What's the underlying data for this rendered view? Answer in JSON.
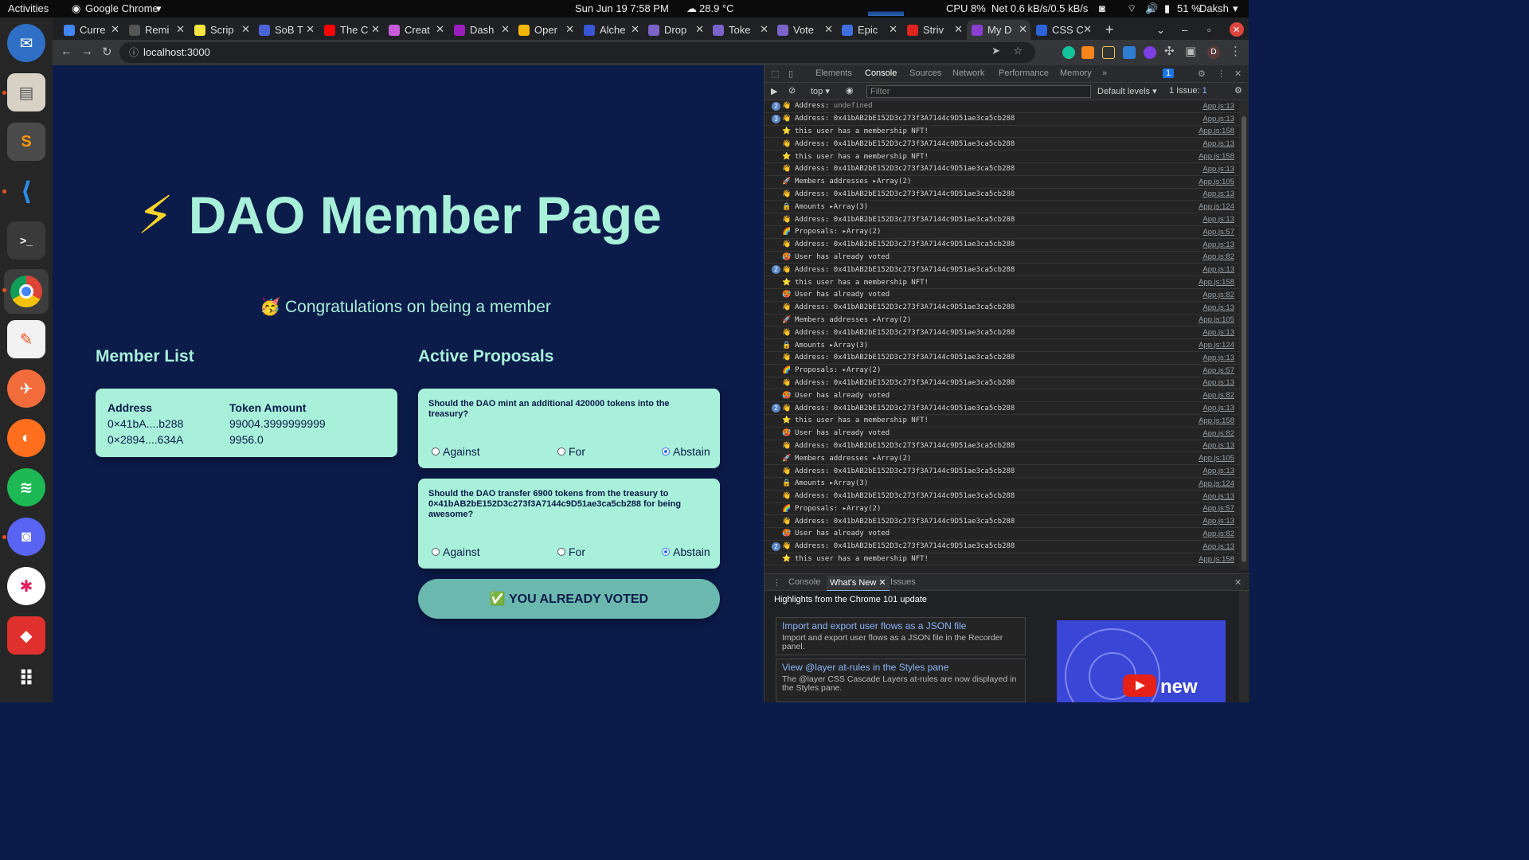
{
  "topbar": {
    "activities": "Activities",
    "app_name": "Google Chrome",
    "clock": "Sun Jun 19  7:58 PM",
    "weather": "28.9 °C",
    "cpu": "CPU 8%",
    "net": "Net 0.6 kB/s/0.5 kB/s",
    "battery": "51 %",
    "user": "Daksh"
  },
  "browser": {
    "tabs": [
      {
        "label": "Curre",
        "color": "#4285f4"
      },
      {
        "label": "Remi",
        "color": "#555555"
      },
      {
        "label": "Scrip",
        "color": "#f5e642"
      },
      {
        "label": "SoB T",
        "color": "#4b63d8"
      },
      {
        "label": "The C",
        "color": "#ff0000"
      },
      {
        "label": "Creat",
        "color": "#c85bd8"
      },
      {
        "label": "Dash",
        "color": "#9b1fbf"
      },
      {
        "label": "Oper",
        "color": "#f2b807"
      },
      {
        "label": "Alche",
        "color": "#3956d6"
      },
      {
        "label": "Drop",
        "color": "#7a63c9"
      },
      {
        "label": "Toke",
        "color": "#7a63c9"
      },
      {
        "label": "Vote",
        "color": "#7a63c9"
      },
      {
        "label": "Epic",
        "color": "#3f6fe0"
      },
      {
        "label": "Striv",
        "color": "#e0251f"
      },
      {
        "label": "My D",
        "color": "#8b3fd0"
      },
      {
        "label": "CSS C",
        "color": "#2d63d8"
      }
    ],
    "new_tab": "+",
    "url": "localhost:3000"
  },
  "page": {
    "bolt": "⚡",
    "title": "DAO Member Page",
    "congrats_emoji": "🥳",
    "congrats": "Congratulations on being a member",
    "member_list_heading": "Member List",
    "members_headers": {
      "address": "Address",
      "amount": "Token Amount"
    },
    "members": [
      {
        "address": "0×41bA....b288",
        "amount": "99004.3999999999"
      },
      {
        "address": "0×2894....634A",
        "amount": "9956.0"
      }
    ],
    "proposals_heading": "Active Proposals",
    "proposals": [
      {
        "question": "Should the DAO mint an additional 420000 tokens into the treasury?",
        "options": [
          "Against",
          "For",
          "Abstain"
        ],
        "selected": "Abstain"
      },
      {
        "question": "Should the DAO transfer 6900 tokens from the treasury to 0×41bAB2bE152D3c273f3A7144c9D51ae3ca5cb288 for being awesome?",
        "options": [
          "Against",
          "For",
          "Abstain"
        ],
        "selected": "Abstain"
      }
    ],
    "voted_button": "✅ YOU ALREADY VOTED"
  },
  "devtools": {
    "tabs": [
      "Elements",
      "Console",
      "Sources",
      "Network",
      "Performance",
      "Memory"
    ],
    "selected_tab": "Console",
    "issues_badge": "1",
    "context": "top",
    "filter_placeholder": "Filter",
    "levels": "Default levels",
    "issue_count": "1 Issue:",
    "issue_num": "1",
    "logs": [
      {
        "count": "2",
        "emoji": "👋",
        "msg": "Address: ",
        "extra": "undefined",
        "src": "App.js:13"
      },
      {
        "count": "3",
        "emoji": "👋",
        "msg": "Address: 0x41bAB2bE152D3c273f3A7144c9D51ae3ca5cb288",
        "src": "App.js:13"
      },
      {
        "emoji": "⭐",
        "msg": "this user has a membership NFT!",
        "src": "App.js:158"
      },
      {
        "emoji": "👋",
        "msg": "Address: 0x41bAB2bE152D3c273f3A7144c9D51ae3ca5cb288",
        "src": "App.js:13"
      },
      {
        "emoji": "⭐",
        "msg": "this user has a membership NFT!",
        "src": "App.js:158"
      },
      {
        "emoji": "👋",
        "msg": "Address: 0x41bAB2bE152D3c273f3A7144c9D51ae3ca5cb288",
        "src": "App.js:13"
      },
      {
        "emoji": "🚀",
        "msg": "Members addresses ▸Array(2)",
        "src": "App.js:105"
      },
      {
        "emoji": "👋",
        "msg": "Address: 0x41bAB2bE152D3c273f3A7144c9D51ae3ca5cb288",
        "src": "App.js:13"
      },
      {
        "emoji": "🔒",
        "msg": "Amounts ▸Array(3)",
        "src": "App.js:124"
      },
      {
        "emoji": "👋",
        "msg": "Address: 0x41bAB2bE152D3c273f3A7144c9D51ae3ca5cb288",
        "src": "App.js:13"
      },
      {
        "emoji": "🌈",
        "msg": "Proposals: ▸Array(2)",
        "src": "App.js:57"
      },
      {
        "emoji": "👋",
        "msg": "Address: 0x41bAB2bE152D3c273f3A7144c9D51ae3ca5cb288",
        "src": "App.js:13"
      },
      {
        "emoji": "🥵",
        "msg": "User has already voted",
        "src": "App.js:82"
      },
      {
        "count": "2",
        "emoji": "👋",
        "msg": "Address: 0x41bAB2bE152D3c273f3A7144c9D51ae3ca5cb288",
        "src": "App.js:13"
      },
      {
        "emoji": "⭐",
        "msg": "this user has a membership NFT!",
        "src": "App.js:158"
      },
      {
        "emoji": "🥵",
        "msg": "User has already voted",
        "src": "App.js:82"
      },
      {
        "emoji": "👋",
        "msg": "Address: 0x41bAB2bE152D3c273f3A7144c9D51ae3ca5cb288",
        "src": "App.js:13"
      },
      {
        "emoji": "🚀",
        "msg": "Members addresses ▸Array(2)",
        "src": "App.js:105"
      },
      {
        "emoji": "👋",
        "msg": "Address: 0x41bAB2bE152D3c273f3A7144c9D51ae3ca5cb288",
        "src": "App.js:13"
      },
      {
        "emoji": "🔒",
        "msg": "Amounts ▸Array(3)",
        "src": "App.js:124"
      },
      {
        "emoji": "👋",
        "msg": "Address: 0x41bAB2bE152D3c273f3A7144c9D51ae3ca5cb288",
        "src": "App.js:13"
      },
      {
        "emoji": "🌈",
        "msg": "Proposals: ▸Array(2)",
        "src": "App.js:57"
      },
      {
        "emoji": "👋",
        "msg": "Address: 0x41bAB2bE152D3c273f3A7144c9D51ae3ca5cb288",
        "src": "App.js:13"
      },
      {
        "emoji": "🥵",
        "msg": "User has already voted",
        "src": "App.js:82"
      },
      {
        "count": "2",
        "emoji": "👋",
        "msg": "Address: 0x41bAB2bE152D3c273f3A7144c9D51ae3ca5cb288",
        "src": "App.js:13"
      },
      {
        "emoji": "⭐",
        "msg": "this user has a membership NFT!",
        "src": "App.js:158"
      },
      {
        "emoji": "🥵",
        "msg": "User has already voted",
        "src": "App.js:82"
      },
      {
        "emoji": "👋",
        "msg": "Address: 0x41bAB2bE152D3c273f3A7144c9D51ae3ca5cb288",
        "src": "App.js:13"
      },
      {
        "emoji": "🚀",
        "msg": "Members addresses ▸Array(2)",
        "src": "App.js:105"
      },
      {
        "emoji": "👋",
        "msg": "Address: 0x41bAB2bE152D3c273f3A7144c9D51ae3ca5cb288",
        "src": "App.js:13"
      },
      {
        "emoji": "🔒",
        "msg": "Amounts ▸Array(3)",
        "src": "App.js:124"
      },
      {
        "emoji": "👋",
        "msg": "Address: 0x41bAB2bE152D3c273f3A7144c9D51ae3ca5cb288",
        "src": "App.js:13"
      },
      {
        "emoji": "🌈",
        "msg": "Proposals: ▸Array(2)",
        "src": "App.js:57"
      },
      {
        "emoji": "👋",
        "msg": "Address: 0x41bAB2bE152D3c273f3A7144c9D51ae3ca5cb288",
        "src": "App.js:13"
      },
      {
        "emoji": "🥵",
        "msg": "User has already voted",
        "src": "App.js:82"
      },
      {
        "count": "2",
        "emoji": "👋",
        "msg": "Address: 0x41bAB2bE152D3c273f3A7144c9D51ae3ca5cb288",
        "src": "App.js:13"
      },
      {
        "emoji": "⭐",
        "msg": "this user has a membership NFT!",
        "src": "App.js:158"
      }
    ],
    "drawer_tabs": [
      "Console",
      "What's New",
      "Issues"
    ],
    "drawer_selected": "What's New",
    "whatsnew_heading": "Highlights from the Chrome 101 update",
    "whatsnew_cards": [
      {
        "title": "Import and export user flows as a JSON file",
        "desc": "Import and export user flows as a JSON file in the Recorder panel."
      },
      {
        "title": "View @layer at-rules in the Styles pane",
        "desc": "The @layer CSS Cascade Layers at-rules are now displayed in the Styles pane."
      }
    ],
    "thumb_text": "new"
  }
}
